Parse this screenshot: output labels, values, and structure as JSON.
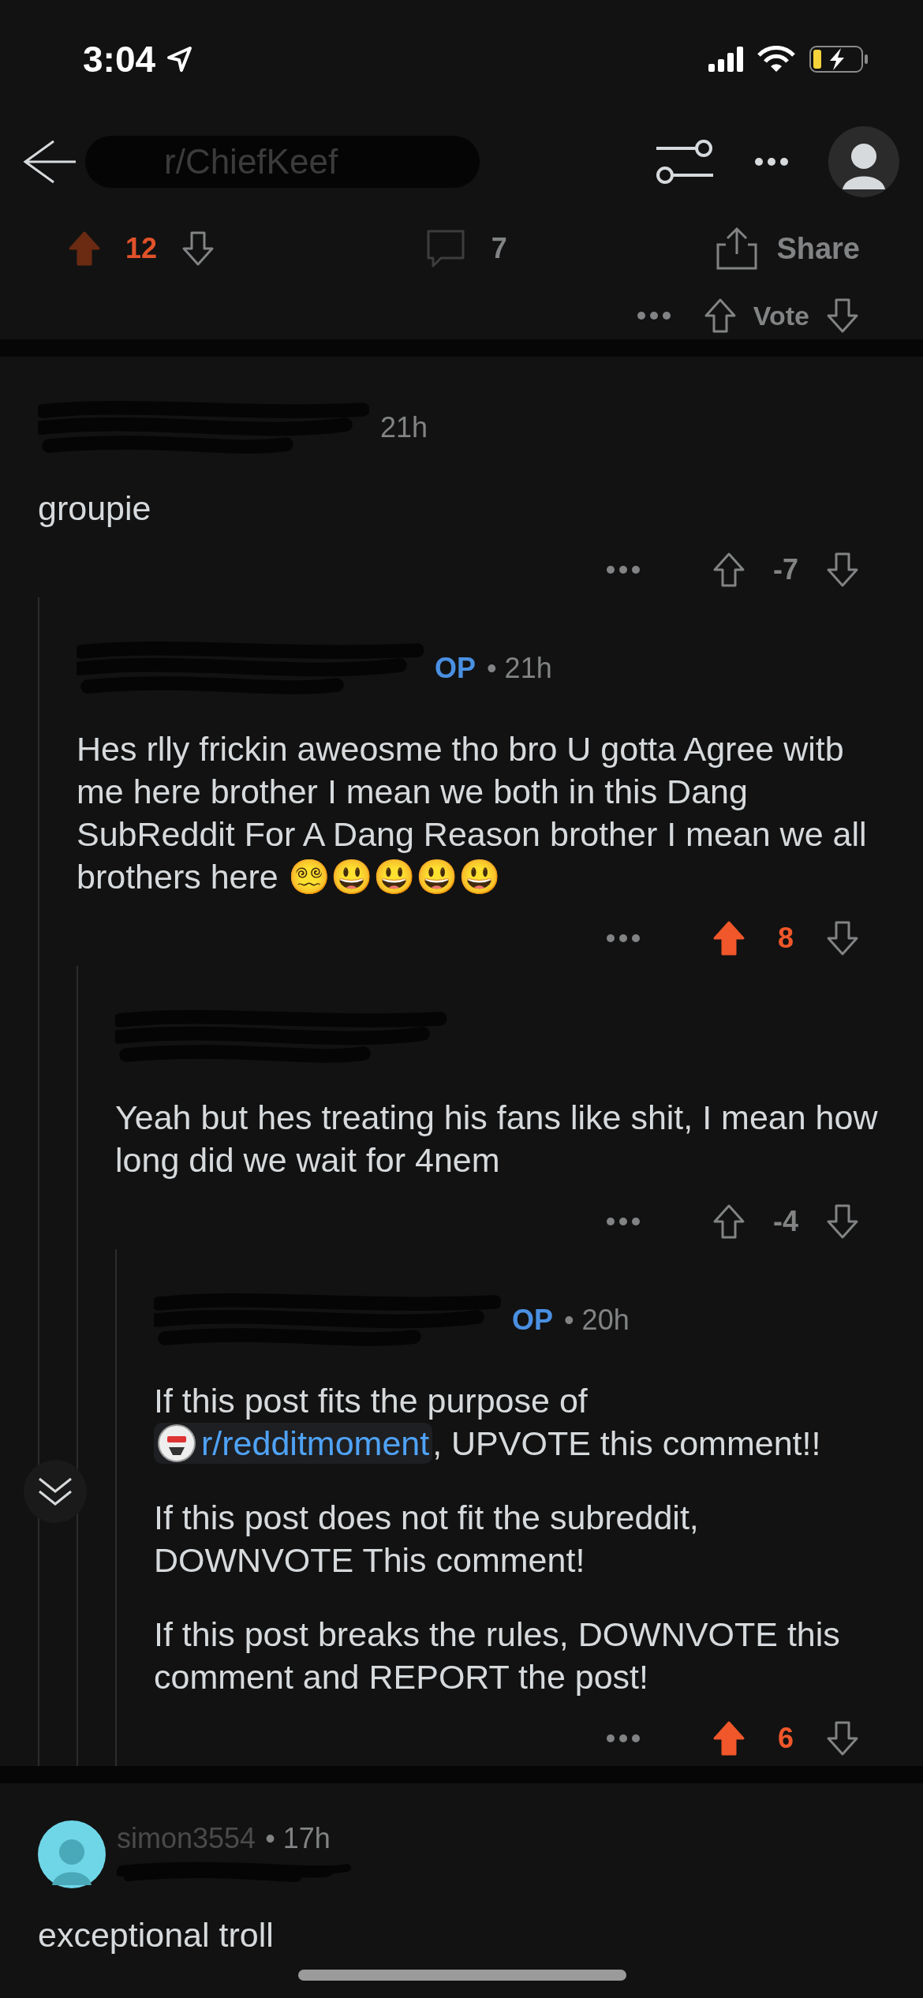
{
  "status_bar": {
    "time": "3:04"
  },
  "header": {
    "title": "r/ChiefKeef"
  },
  "post_actions": {
    "upvoted": true,
    "score": "12",
    "comments": "7",
    "share": "Share"
  },
  "partial_row": {
    "vote_label": "Vote"
  },
  "comments": [
    {
      "redacted": true,
      "time": "21h",
      "score": "-7",
      "upvoted": false,
      "body": [
        [
          {
            "kind": "text",
            "text": "groupie"
          }
        ]
      ],
      "children": [
        {
          "redacted": true,
          "op": "OP",
          "time": "• 21h",
          "score": "8",
          "upvoted": true,
          "body": [
            [
              {
                "kind": "text",
                "text": "Hes rlly frickin aweosme tho bro U gotta Agree witb me here brother I mean we both in this Dang SubReddit For A Dang Reason brother I mean we all brothers here 😵‍💫😃😃😃😃"
              }
            ]
          ],
          "children": [
            {
              "redacted": true,
              "score": "-4",
              "upvoted": false,
              "body": [
                [
                  {
                    "kind": "text",
                    "text": "Yeah but hes treating his fans like shit, I mean how long did we wait for 4nem"
                  }
                ]
              ],
              "children": [
                {
                  "redacted": true,
                  "op": "OP",
                  "time": "• 20h",
                  "score": "6",
                  "upvoted": true,
                  "body": [
                    [
                      {
                        "kind": "text",
                        "text": "If this post fits the purpose of "
                      },
                      {
                        "kind": "link",
                        "text": "r/redditmoment"
                      },
                      {
                        "kind": "text",
                        "text": ", UPVOTE this comment!!"
                      }
                    ],
                    [
                      {
                        "kind": "text",
                        "text": "If this post does not fit the subreddit, DOWNVOTE This comment!"
                      }
                    ],
                    [
                      {
                        "kind": "text",
                        "text": "If this post breaks the rules, DOWNVOTE this comment and REPORT the post!"
                      }
                    ]
                  ]
                }
              ]
            }
          ]
        }
      ]
    },
    {
      "redacted": true,
      "author": "simon3554",
      "time": "• 17h",
      "kind": "avatar",
      "body": [
        [
          {
            "kind": "text",
            "text": "exceptional troll"
          }
        ]
      ]
    }
  ]
}
